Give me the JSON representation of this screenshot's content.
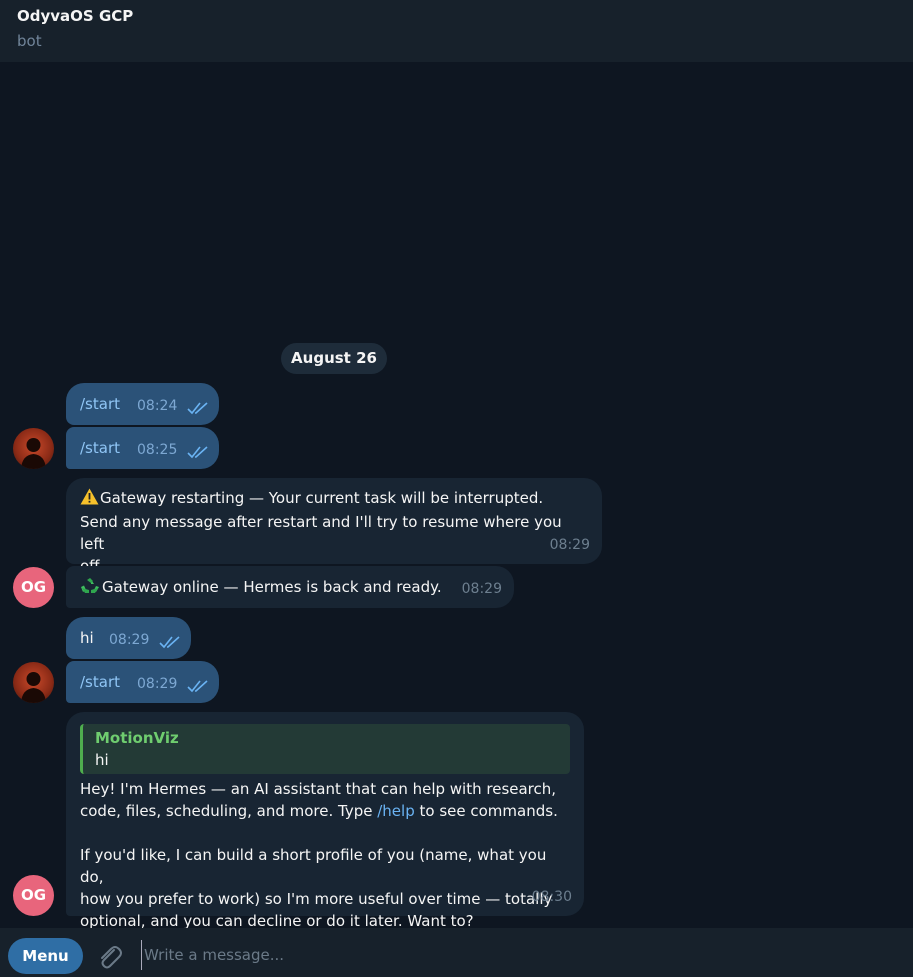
{
  "header": {
    "title": "OdyvaOS GCP",
    "subtitle": "bot"
  },
  "date_separator": "August 26",
  "messages": [
    {
      "text": "/start",
      "time": "08:24",
      "dir": "out"
    },
    {
      "text": "/start",
      "time": "08:25",
      "dir": "out"
    },
    {
      "line1": "Gateway restarting — Your current task will be interrupted.",
      "line2": "Send any message after restart and I'll try to resume where you left",
      "line3": "off.",
      "time": "08:29",
      "icon": "warning-icon",
      "dir": "in"
    },
    {
      "text": "Gateway online — Hermes is back and ready.",
      "time": "08:29",
      "icon": "recycle-icon",
      "dir": "in"
    },
    {
      "text": "hi",
      "time": "08:29",
      "dir": "out"
    },
    {
      "text": "/start",
      "time": "08:29",
      "dir": "out"
    },
    {
      "reply_to": {
        "author": "MotionViz",
        "text": "hi"
      },
      "p1_line1": "Hey! I'm Hermes — an AI assistant that can help with research,",
      "p1_line2_before": "code, files, scheduling, and more. Type",
      "p1_link": "/help",
      "p1_line2_after": "to see commands.",
      "p2_line1": "If you'd like, I can build a short profile of you (name, what you do,",
      "p2_line2": "how you prefer to work) so I'm more useful over time — totally",
      "p2_line3": "optional, and you can decline or do it later. Want to?",
      "time": "08:30",
      "dir": "in"
    }
  ],
  "avatars": {
    "bot_initials": "OG"
  },
  "composer": {
    "menu_label": "Menu",
    "placeholder": "Write a message..."
  },
  "colors": {
    "accent": "#2f6ea5",
    "out_bubble": "#2b5278",
    "in_bubble": "#182533",
    "bg": "#0e1621"
  }
}
